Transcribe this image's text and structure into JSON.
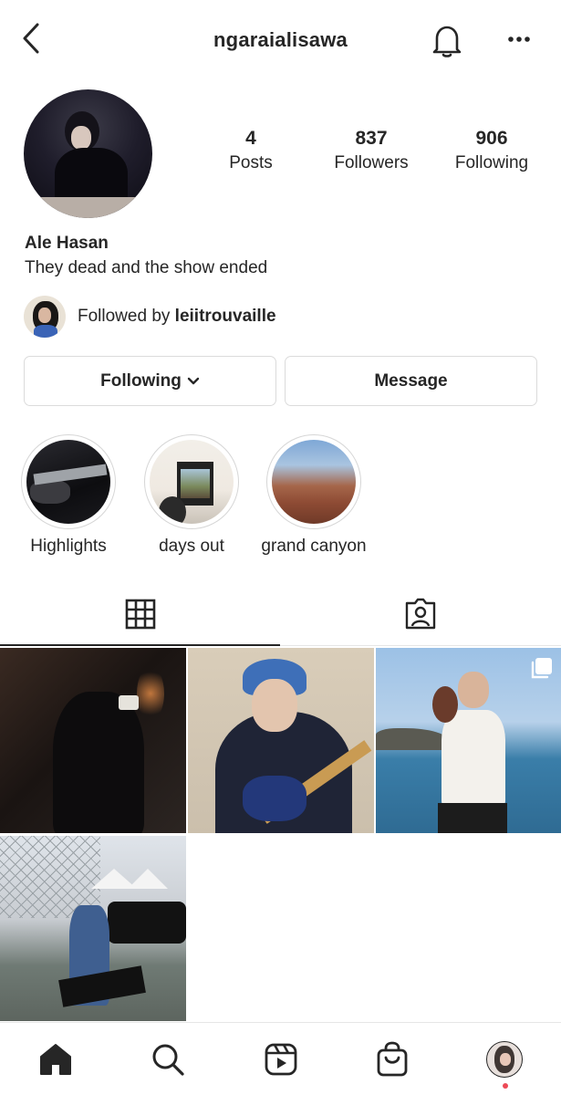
{
  "header": {
    "username": "ngaraialisawa",
    "icons": {
      "back": "chevron-left-icon",
      "bell": "bell-icon",
      "more": "more-horizontal-icon"
    }
  },
  "profile": {
    "name": "Ale Hasan",
    "bio": "They dead and the show ended",
    "stats": [
      {
        "value": "4",
        "label": "Posts"
      },
      {
        "value": "837",
        "label": "Followers"
      },
      {
        "value": "906",
        "label": "Following"
      }
    ],
    "followed_by": {
      "prefix": "Followed by ",
      "username": "leiitrouvaille"
    }
  },
  "actions": {
    "following_label": "Following",
    "message_label": "Message"
  },
  "highlights": [
    {
      "label": "Highlights"
    },
    {
      "label": "days out"
    },
    {
      "label": "grand canyon"
    }
  ],
  "tabs": [
    {
      "name": "posts-grid",
      "icon": "grid-icon",
      "active": true
    },
    {
      "name": "tagged",
      "icon": "tagged-person-icon",
      "active": false
    }
  ],
  "posts": [
    {
      "name": "post-1"
    },
    {
      "name": "post-2"
    },
    {
      "name": "post-3",
      "multiple": true
    },
    {
      "name": "post-4"
    }
  ],
  "bottom_nav": [
    {
      "name": "home",
      "icon": "home-icon",
      "active": true
    },
    {
      "name": "search",
      "icon": "search-icon"
    },
    {
      "name": "reels",
      "icon": "reels-icon"
    },
    {
      "name": "shop",
      "icon": "shop-bag-icon"
    },
    {
      "name": "profile",
      "icon": "profile-avatar-icon",
      "notification": true
    }
  ],
  "colors": {
    "text": "#262626",
    "border": "#dbdbdb",
    "notification": "#ed4956"
  }
}
